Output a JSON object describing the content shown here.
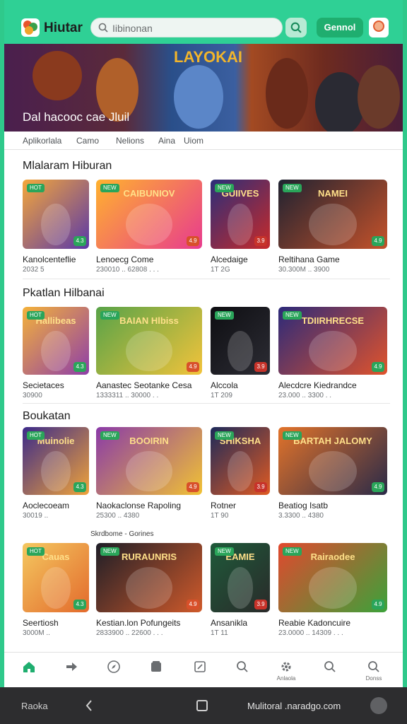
{
  "app": {
    "name": "Hiutar",
    "search_placeholder": "Iibinonan",
    "cta_label": "Gennol"
  },
  "banner": {
    "title": "LAYOKAI",
    "caption": "Dal hacooc cae Jluil"
  },
  "tabs": [
    "Aplikorlala",
    "Camo",
    "Nelions",
    "Aina",
    "Uiom"
  ],
  "sections": [
    {
      "title": "Mlalaram Hiburan",
      "cards": [
        {
          "name": "Kanolcenteflie",
          "meta": "2032 5",
          "art": "",
          "badge": "",
          "colors": [
            "#f4a73a",
            "#5a38a8"
          ]
        },
        {
          "name": "Lenoecg Come",
          "meta": "230010 .. 62808 . . .",
          "art": "CAIBUNIOV",
          "badge": "",
          "colors": [
            "#ffb22e",
            "#e83b8e"
          ]
        },
        {
          "name": "Alcedaige",
          "meta": "1T 2G",
          "art": "GUIIVES",
          "badge": "",
          "colors": [
            "#2b2e7a",
            "#c72a2a"
          ]
        },
        {
          "name": "Reltihana Game",
          "meta": "30.300M .. 3900",
          "art": "NAMEI",
          "badge": "",
          "colors": [
            "#1f2231",
            "#c5522a"
          ]
        }
      ]
    },
    {
      "title": "Pkatlan Hilbanai",
      "cards": [
        {
          "name": "Secietaces",
          "meta": "30900",
          "art": "Hallibeas",
          "badge": "",
          "colors": [
            "#f4b23a",
            "#8e3ea8"
          ]
        },
        {
          "name": "Aanastec Seotanke Cesa",
          "meta": "1333311 .. 30000 . .",
          "art": "BAIAN Hlbiss",
          "badge": "",
          "colors": [
            "#58a348",
            "#f2c33b"
          ]
        },
        {
          "name": "Alccola",
          "meta": "1T 209",
          "art": "",
          "badge": "",
          "colors": [
            "#0e0e12",
            "#2c2c34"
          ]
        },
        {
          "name": "Alecdcre Kiedrandce",
          "meta": "23.000 .. 3300 . .",
          "art": "TDIIRHRECSE",
          "badge": "",
          "colors": [
            "#2c2a7a",
            "#e0532c"
          ]
        }
      ]
    },
    {
      "title": "Boukatan",
      "cards": [
        {
          "name": "Aoclecoeam",
          "meta": "30019 ..",
          "art": "Muinolie",
          "badge": "",
          "colors": [
            "#3b2a8a",
            "#f0a33a"
          ]
        },
        {
          "name": "Naokaclonse Rapoling",
          "meta": "25300 .. 4380",
          "art": "BOOIRIN",
          "badge": "",
          "colors": [
            "#8a3aa8",
            "#f1c234"
          ]
        },
        {
          "name": "Rotner",
          "meta": "1T 90",
          "art": "SHIKSHA",
          "badge": "",
          "colors": [
            "#1c2a5a",
            "#e05a22"
          ]
        },
        {
          "name": "Beatiog Isatb",
          "meta": "3.3300 .. 4380",
          "art": "BARTAH JALOMY",
          "badge": "",
          "colors": [
            "#e2732a",
            "#2a2a48"
          ]
        }
      ]
    },
    {
      "title": "Skrdbome - Gorines",
      "cards": [
        {
          "name": "Seertiosh",
          "meta": "3000M ..",
          "art": "Cauas",
          "badge": "",
          "colors": [
            "#f4c860",
            "#e36a2c"
          ]
        },
        {
          "name": "Kestian.lon Pofungeits",
          "meta": "2833900 .. 22600 . . .",
          "art": "RURAUNRIS",
          "badge": "",
          "colors": [
            "#1e1e28",
            "#d05a2a"
          ]
        },
        {
          "name": "Ansanikla",
          "meta": "1T 11",
          "art": "EAMIE",
          "badge": "",
          "colors": [
            "#1e5a3a",
            "#2a2a2a"
          ]
        },
        {
          "name": "Reabie Kadoncuire",
          "meta": "23.0000 .. 14309 . . .",
          "art": "Rairaodee",
          "badge": "",
          "colors": [
            "#e1482e",
            "#3ca23a"
          ]
        }
      ]
    }
  ],
  "badges": {
    "top": [
      "HOT",
      "NEW",
      "NEW",
      "NEW"
    ],
    "bottom": [
      "4.3",
      "4.9",
      "3.9",
      "4.9"
    ]
  },
  "bottom_nav": [
    {
      "icon": "home-icon",
      "label": ""
    },
    {
      "icon": "share-icon",
      "label": ""
    },
    {
      "icon": "compass-icon",
      "label": ""
    },
    {
      "icon": "library-icon",
      "label": ""
    },
    {
      "icon": "edit-icon",
      "label": ""
    },
    {
      "icon": "search-icon",
      "label": ""
    },
    {
      "icon": "settings-icon",
      "label": "Anlaola"
    },
    {
      "icon": "search-icon",
      "label": ""
    },
    {
      "icon": "search-icon",
      "label": "Donss"
    }
  ],
  "system_bar": {
    "left_label": "Raoka",
    "url": "Mulitoral .naradgo.com"
  },
  "colors": {
    "accent": "#2fd095",
    "cta": "#1fae6f"
  }
}
